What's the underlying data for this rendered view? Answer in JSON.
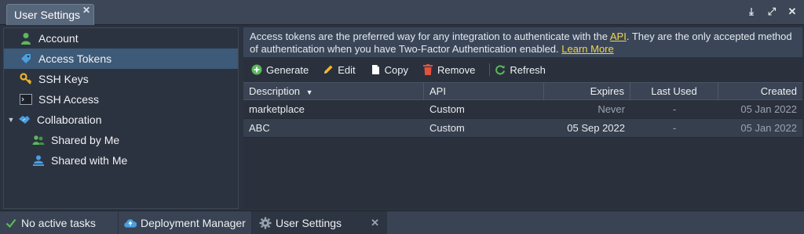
{
  "window": {
    "tab_title": "User Settings",
    "tab_close": "✕",
    "controls": {
      "download": "⤓",
      "expand": "⤢",
      "close": "✕"
    }
  },
  "sidebar": {
    "items": [
      {
        "label": "Account",
        "icon": "user-icon"
      },
      {
        "label": "Access Tokens",
        "icon": "tag-icon",
        "selected": true
      },
      {
        "label": "SSH Keys",
        "icon": "key-icon"
      },
      {
        "label": "SSH Access",
        "icon": "terminal-icon"
      },
      {
        "label": "Collaboration",
        "icon": "handshake-icon",
        "expanded": true
      },
      {
        "label": "Shared by Me",
        "icon": "users-icon"
      },
      {
        "label": "Shared with Me",
        "icon": "user-share-icon"
      }
    ]
  },
  "info": {
    "text_before_api": "Access tokens are the preferred way for any integration to authenticate with the ",
    "api_link": "API",
    "text_after_api": ". They are the only accepted method of authentication when you have Two-Factor Authentication enabled.",
    "learn_more": "Learn More"
  },
  "toolbar": {
    "generate": "Generate",
    "edit": "Edit",
    "copy": "Copy",
    "remove": "Remove",
    "refresh": "Refresh"
  },
  "grid": {
    "columns": [
      "Description",
      "API",
      "Expires",
      "Last Used",
      "Created"
    ],
    "sort_indicator": "▼",
    "rows": [
      {
        "description": "marketplace",
        "api": "Custom",
        "expires": "Never",
        "last_used": "-",
        "created": "05 Jan 2022"
      },
      {
        "description": "ABC",
        "api": "Custom",
        "expires": "05 Sep 2022",
        "last_used": "-",
        "created": "05 Jan 2022"
      }
    ]
  },
  "taskbar": {
    "status": "No active tasks",
    "deployment_manager": "Deployment Manager",
    "user_settings": "User Settings",
    "close": "✕"
  },
  "colors": {
    "accent_selected": "#3d5a78",
    "link": "#f0d64a",
    "green": "#5cb85c",
    "blue_icon": "#4a9fe0"
  }
}
